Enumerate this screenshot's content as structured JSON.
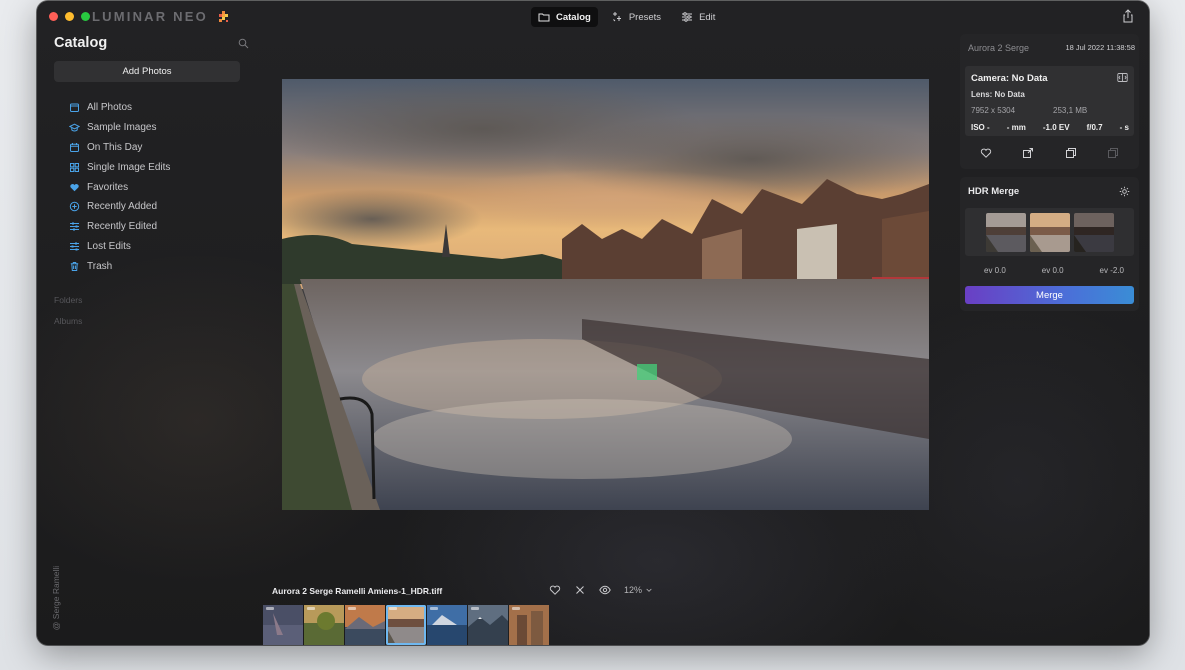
{
  "window": {
    "app_name": "LUMINAR NEO",
    "tabs": [
      {
        "label": "Catalog",
        "icon": "folder-icon",
        "active": true
      },
      {
        "label": "Presets",
        "icon": "presets-sparkle-icon",
        "active": false
      },
      {
        "label": "Edit",
        "icon": "sliders-icon",
        "active": false
      }
    ]
  },
  "sidebar": {
    "title": "Catalog",
    "add_photos_label": "Add Photos",
    "items": [
      {
        "label": "All Photos",
        "icon": "photos-icon"
      },
      {
        "label": "Sample Images",
        "icon": "graduation-cap-icon"
      },
      {
        "label": "On This Day",
        "icon": "calendar-icon"
      },
      {
        "label": "Single Image Edits",
        "icon": "grid-icon"
      },
      {
        "label": "Favorites",
        "icon": "heart-icon"
      },
      {
        "label": "Recently Added",
        "icon": "plus-circle-icon"
      },
      {
        "label": "Recently Edited",
        "icon": "sliders-icon"
      },
      {
        "label": "Lost Edits",
        "icon": "sliders-icon"
      },
      {
        "label": "Trash",
        "icon": "trash-icon"
      }
    ],
    "folders_label": "Folders",
    "albums_label": "Albums",
    "credit": "@ Serge Ramelli"
  },
  "info": {
    "author": "Aurora 2 Serge",
    "date": "18 Jul 2022 11:38:58",
    "camera": "Camera: No Data",
    "lens": "Lens: No Data",
    "resolution": "7952 x 5304",
    "file_size": "253,1 MB",
    "exif": [
      "ISO -",
      "- mm",
      "-1.0 EV",
      "f/0.7",
      "- s"
    ]
  },
  "hdr": {
    "title": "HDR Merge",
    "ev_values": [
      "ev 0.0",
      "ev 0.0",
      "ev -2.0"
    ],
    "merge_label": "Merge"
  },
  "filmstrip": {
    "filename": "Aurora 2 Serge Ramelli Amiens-1_HDR.tiff",
    "zoom": "12%",
    "selected_index": 3
  },
  "colors": {
    "accent": "#6fb8f0",
    "merge_gradient_start": "#6a3fc4",
    "merge_gradient_end": "#3a8dd6",
    "window_bg": "#1d1d1f"
  }
}
